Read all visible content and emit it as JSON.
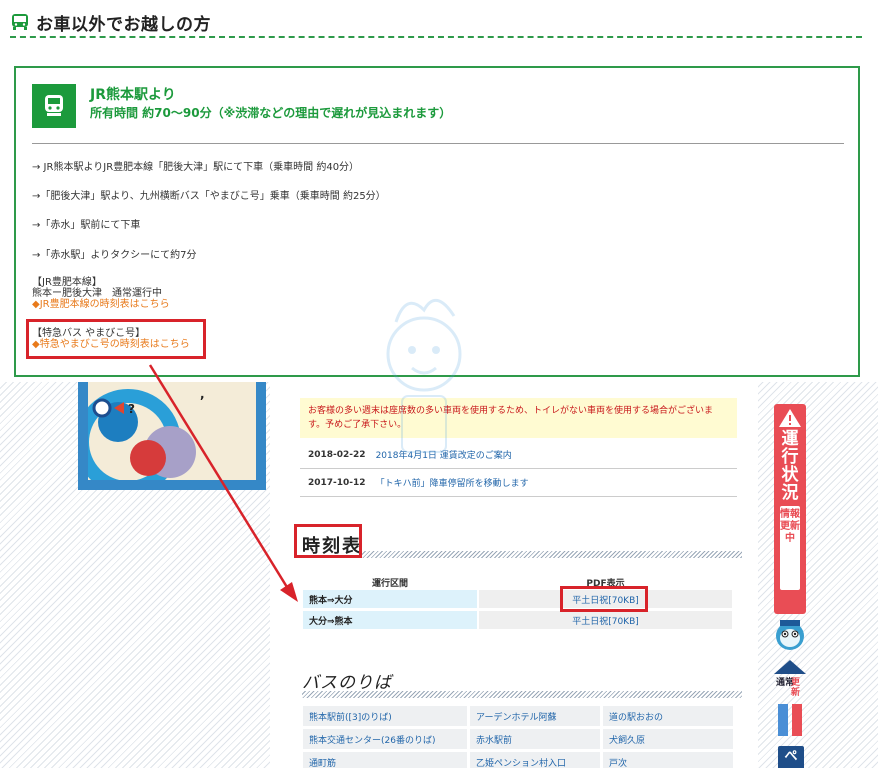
{
  "header": {
    "title": "お車以外でお越しの方"
  },
  "box": {
    "title": "JR熊本駅より",
    "subtitle": "所有時間 約70〜90分（※渋滞などの理由で遅れが見込まれます）",
    "routes": [
      "→ JR熊本駅よりJR豊肥本線「肥後大津」駅にて下車（乗車時間 約40分）",
      "→「肥後大津」駅より、九州横断バス「やまびこ号」乗車（乗車時間 約25分）",
      "→「赤水」駅前にて下車",
      "→「赤水駅」よりタクシーにて約7分"
    ],
    "jr_heading": "【JR豊肥本線】",
    "jr_status": "熊本ー肥後大津　通常運行中",
    "jr_link": "◆JR豊肥本線の時刻表はこちら",
    "bus_heading": "【特急バス やまびこ号】",
    "bus_link": "◆特急やまびこ号の時刻表はこちら"
  },
  "notice": "お客様の多い週末は座席数の多い車両を使用するため、トイレがない車両を使用する場合がございます。予めご了承下さい。",
  "news": [
    {
      "date": "2018-02-22",
      "text": "2018年4月1日 運賃改定のご案内"
    },
    {
      "date": "2017-10-12",
      "text": "「トキハ前」降車停留所を移動します"
    }
  ],
  "timetable": {
    "title": "時刻表",
    "col_route": "運行区間",
    "col_pdf": "PDF表示",
    "rows": [
      {
        "route": "熊本⇒大分",
        "pdf": "平土日祝[70KB]"
      },
      {
        "route": "大分⇒熊本",
        "pdf": "平土日祝[70KB]"
      }
    ]
  },
  "bus_stops": {
    "title": "バスのりば",
    "rows": [
      [
        "熊本駅前([3]のりば)",
        "アーデンホテル阿蘇",
        "道の駅おおの"
      ],
      [
        "熊本交通センター(26番のりば)",
        "赤水駅前",
        "犬飼久原"
      ],
      [
        "通町筋",
        "乙姫ペンション村入口",
        "戸次"
      ]
    ]
  },
  "side": {
    "status_label": "運行状況",
    "status_sub": "情報更新中",
    "normal_label": "通常",
    "update_label": "更新",
    "pagetop": "ぺ"
  },
  "colors": {
    "green": "#1c9a3c",
    "red": "#d8232a",
    "orange": "#e87a1b",
    "link": "#2266aa"
  }
}
